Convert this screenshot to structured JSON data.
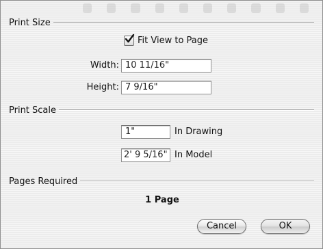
{
  "print_size": {
    "title": "Print Size",
    "fit_view_label": "Fit View to Page",
    "fit_view_checked": true,
    "width_label": "Width:",
    "width_value": "10 11/16\"",
    "height_label": "Height:",
    "height_value": "7 9/16\""
  },
  "print_scale": {
    "title": "Print Scale",
    "drawing_value": "1\"",
    "drawing_label": "In Drawing",
    "model_value": "2' 9 5/16\"",
    "model_label": "In Model"
  },
  "pages_required": {
    "title": "Pages Required",
    "value": "1 Page"
  },
  "buttons": {
    "cancel_label": "Cancel",
    "ok_label": "OK"
  }
}
